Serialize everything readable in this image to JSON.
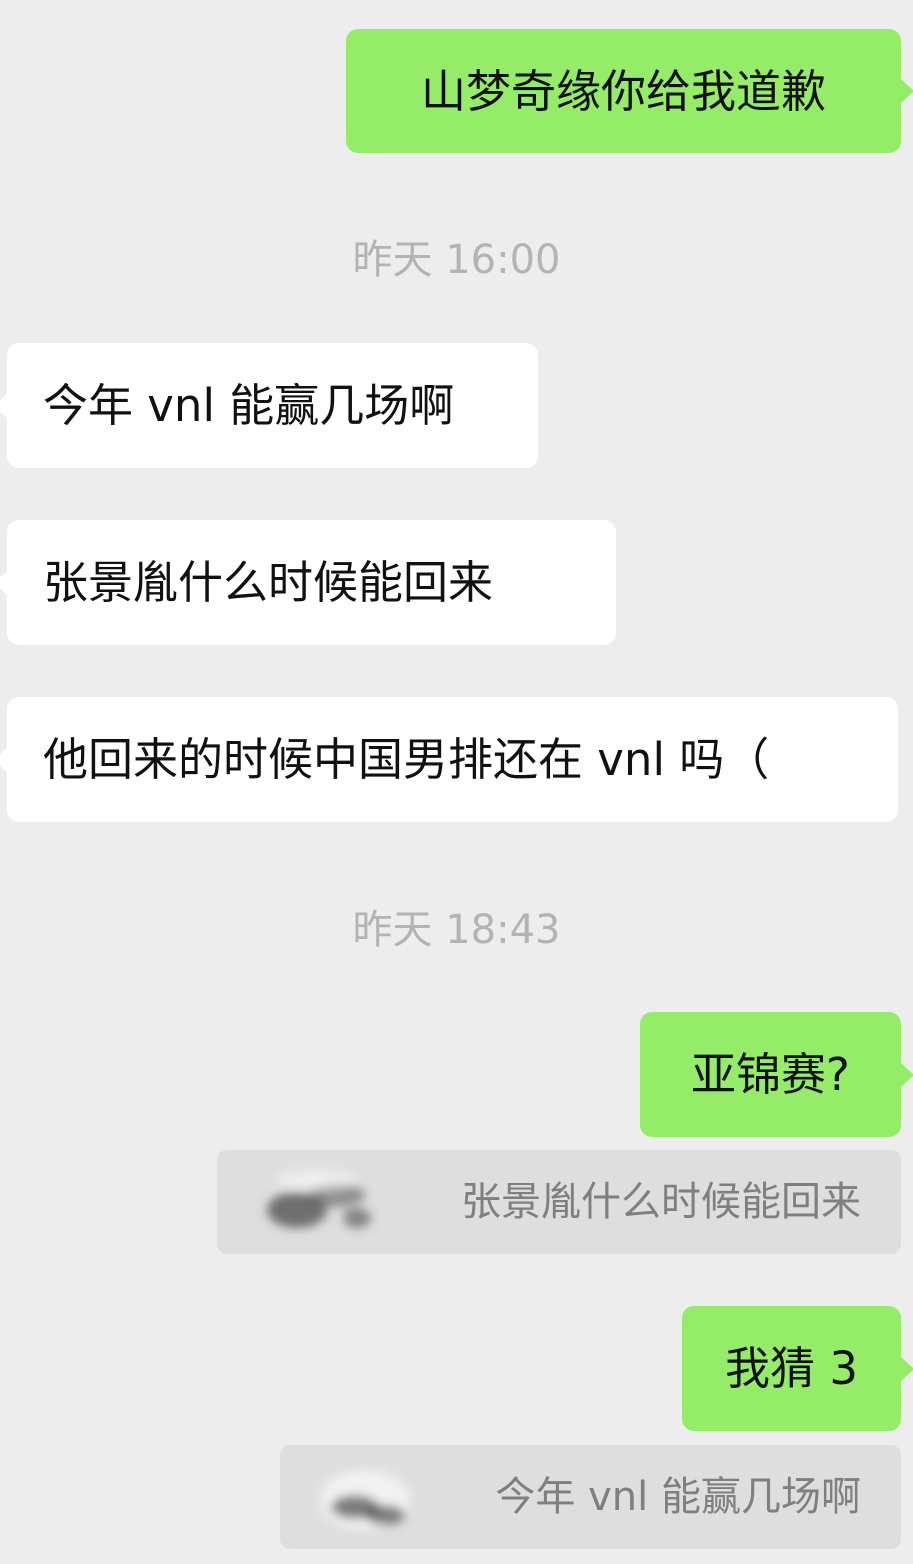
{
  "messages": [
    {
      "side": "sent",
      "text": "山梦奇缘你给我道歉"
    },
    {
      "side": "timestamp",
      "text": "昨天 16:00"
    },
    {
      "side": "received",
      "text": "今年 vnl 能赢几场啊"
    },
    {
      "side": "received",
      "text": "张景胤什么时候能回来"
    },
    {
      "side": "received",
      "text": "他回来的时候中国男排还在 vnl 吗（"
    },
    {
      "side": "timestamp",
      "text": "昨天 18:43"
    },
    {
      "side": "sent",
      "text": "亚锦赛?",
      "quote": "张景胤什么时候能回来"
    },
    {
      "side": "sent",
      "text": "我猜 3",
      "quote": "今年 vnl 能赢几场啊"
    }
  ],
  "colors": {
    "background": "#ededed",
    "sent_bubble": "#95ec69",
    "received_bubble": "#ffffff",
    "quote_bg": "#dedede",
    "timestamp_text": "#b3b3b3",
    "quote_text": "#7f7f7f"
  },
  "icons": {
    "quote_thumbnail": "blurred-image-icon"
  }
}
